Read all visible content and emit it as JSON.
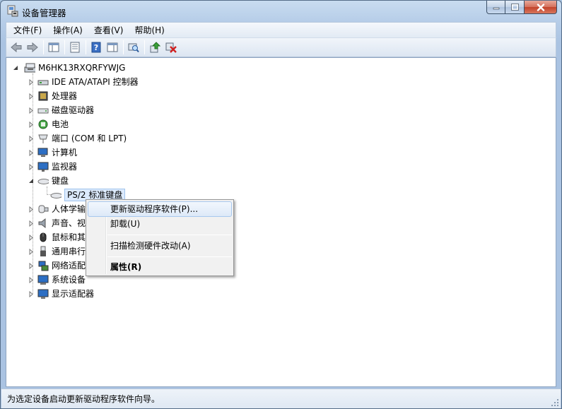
{
  "window": {
    "title": "设备管理器"
  },
  "menu": {
    "items": [
      "文件(F)",
      "操作(A)",
      "查看(V)",
      "帮助(H)"
    ]
  },
  "toolbar": {
    "icons": [
      "back-arrow-icon",
      "forward-arrow-icon",
      "console-tree-icon",
      "properties-icon",
      "help-icon",
      "show-hide-icon",
      "scan-hardware-icon",
      "update-driver-icon",
      "uninstall-icon"
    ]
  },
  "tree": {
    "root": "M6HK13RXQRFYWJG",
    "categories": [
      "IDE ATA/ATAPI 控制器",
      "处理器",
      "磁盘驱动器",
      "电池",
      "端口 (COM 和 LPT)",
      "计算机",
      "监视器",
      "键盘",
      "人体学输入设备",
      "声音、视频和游戏控制器",
      "鼠标和其它指针设备",
      "通用串行总线控制器",
      "网络适配器",
      "系统设备",
      "显示适配器"
    ],
    "keyboard_child": "PS/2 标准键盘"
  },
  "context_menu": {
    "items": [
      "更新驱动程序软件(P)...",
      "卸载(U)",
      "扫描检测硬件改动(A)",
      "属性(R)"
    ]
  },
  "status": {
    "text": "为选定设备启动更新驱动程序软件向导。"
  }
}
